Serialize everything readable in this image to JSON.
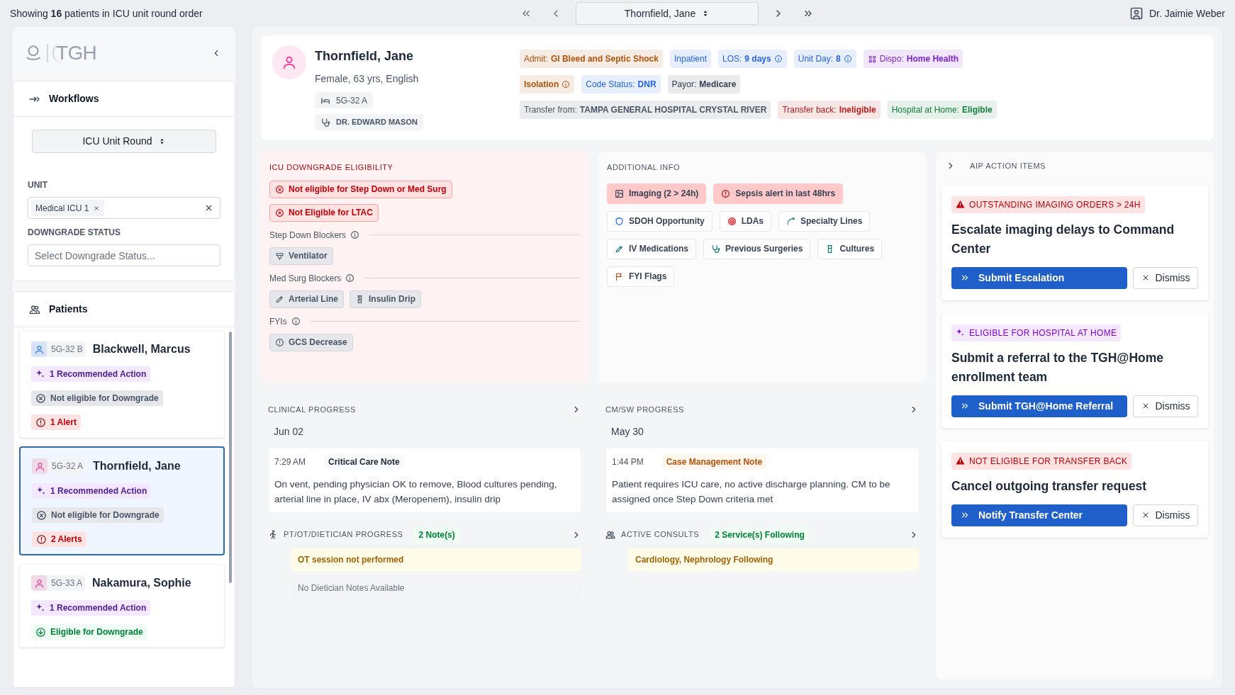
{
  "top_bar": {
    "summary": "Showing **16** patients in ICU unit round order",
    "current_patient": "Thornfield, Jane",
    "user": "Dr. Jaimie Weber"
  },
  "sidebar": {
    "logo": "TGH",
    "workflows": {
      "title": "Workflows",
      "workflow": "ICU Unit Round",
      "unit_label": "UNIT",
      "unit_chip": "Medical ICU 1",
      "status_label": "DOWNGRADE STATUS",
      "status_placeholder": "Select Downgrade Status..."
    },
    "patients": {
      "title": "Patients",
      "items": [
        {
          "room": "5G-32 B",
          "name": "Blackwell, Marcus",
          "color": "#3b82f6",
          "selected": false,
          "recommended": "1 Recommended Action",
          "downgrade": {
            "text": "Not eligible for Downgrade",
            "eligible": false
          },
          "alert": "1 Alert"
        },
        {
          "room": "5G-32 A",
          "name": "Thornfield, Jane",
          "color": "#ec4899",
          "selected": true,
          "recommended": "1 Recommended Action",
          "downgrade": {
            "text": "Not eligible for Downgrade",
            "eligible": false
          },
          "alert": "2 Alerts"
        },
        {
          "room": "5G-33 A",
          "name": "Nakamura, Sophie",
          "color": "#ec4899",
          "selected": false,
          "recommended": "1 Recommended Action",
          "downgrade": {
            "text": "Eligible for Downgrade",
            "eligible": true
          }
        }
      ]
    }
  },
  "header": {
    "name": "Thornfield, Jane",
    "details": "Female, 63 yrs, English",
    "room": "5G-32 A",
    "doctor": "DR. EDWARD MASON",
    "chip_rows": [
      [
        {
          "label": "Admit:",
          "value": "GI Bleed and Septic Shock",
          "color": "#b45309"
        },
        {
          "label": "Inpatient",
          "color": "#2563eb"
        },
        {
          "label": "LOS:",
          "value": "9 days",
          "color": "#2563eb",
          "info": true
        },
        {
          "label": "Unit Day:",
          "value": "8",
          "color": "#2563eb",
          "info": true
        },
        {
          "label": "Dispo:",
          "value": "Home Health",
          "color": "#7e22ce"
        }
      ],
      [
        {
          "value": "Isolation",
          "color": "#b45309",
          "info": true
        },
        {
          "label": "Code Status:",
          "value": "DNR",
          "color": "#2563eb"
        },
        {
          "label": "Payor:",
          "value": "Medicare",
          "color": "#374151"
        }
      ],
      [
        {
          "label": "Transfer from:",
          "value": "TAMPA GENERAL HOSPITAL CRYSTAL RIVER",
          "color": "#4b5563"
        },
        {
          "label": "Transfer back:",
          "value": "Ineligible",
          "color": "#b91c1c"
        },
        {
          "label": "Hospital at Home:",
          "value": "Eligible",
          "color": "#15803d"
        }
      ]
    ]
  },
  "downgrade": {
    "title": "ICU DOWNGRADE ELIGIBILITY",
    "statuses": [
      "Not eligible for Step Down or Med Surg",
      "Not Eligible for LTAC"
    ],
    "groups": [
      {
        "title": "Step Down Blockers",
        "items": [
          "Ventilator"
        ]
      },
      {
        "title": "Med Surg Blockers",
        "items": [
          "Arterial Line",
          "Insulin Drip"
        ]
      },
      {
        "title": "FYIs",
        "items": [
          "GCS Decrease"
        ]
      }
    ]
  },
  "additional_info": {
    "title": "ADDITIONAL INFO",
    "items": [
      {
        "label": "Imaging (2 > 24h)",
        "highlighted": true
      },
      {
        "label": "Sepsis alert in last 48hrs",
        "highlighted": true
      },
      {
        "label": "SDOH Opportunity",
        "highlighted": false
      },
      {
        "label": "LDAs",
        "highlighted": false
      },
      {
        "label": "Specialty Lines",
        "highlighted": false
      },
      {
        "label": "IV Medications",
        "highlighted": false
      },
      {
        "label": "Previous Surgeries",
        "highlighted": false
      },
      {
        "label": "Cultures",
        "highlighted": false
      },
      {
        "label": "FYI Flags",
        "highlighted": false
      }
    ]
  },
  "clinical_progress": {
    "title": "CLINICAL PROGRESS",
    "date": "Jun 02",
    "time": "7:29 AM",
    "note_type": "Critical Care Note",
    "highlighted": false,
    "text": "On vent, pending physician OK to remove, Blood cultures pending, arterial line in place, IV abx (Meropenem), insulin drip"
  },
  "cmsw_progress": {
    "title": "CM/SW PROGRESS",
    "date": "May 30",
    "time": "1:44 PM",
    "note_type": "Case Management Note",
    "highlighted": true,
    "text": "Patient requires ICU care, no active discharge planning. CM to be assigned once Step Down criteria met"
  },
  "pt_ot_progress": {
    "title": "PT/OT/DIETICIAN PROGRESS",
    "badge": "2 Note(s)",
    "notes": [
      {
        "text": "OT session not performed",
        "highlighted": true
      },
      {
        "text": "No Dietician Notes Available",
        "highlighted": false
      }
    ]
  },
  "active_consults": {
    "title": "ACTIVE CONSULTS",
    "badge": "2 Service(s) Following",
    "notes": [
      {
        "text": "Cardiology, Nephrology Following",
        "highlighted": true
      }
    ]
  },
  "aip": {
    "title": "AIP ACTION ITEMS",
    "items": [
      {
        "kind": "warning",
        "category": "OUTSTANDING IMAGING ORDERS > 24H",
        "title": "Escalate imaging delays to Command Center",
        "action": "Submit Escalation",
        "dismiss": "Dismiss"
      },
      {
        "kind": "eligible",
        "category": "ELIGIBLE FOR HOSPITAL AT HOME",
        "title": "Submit a referral to the TGH@Home enrollment team",
        "action": "Submit TGH@Home Referral",
        "dismiss": "Dismiss"
      },
      {
        "kind": "warning",
        "category": "NOT ELIGIBLE FOR TRANSFER BACK",
        "title": "Cancel outgoing transfer request",
        "action": "Notify Transfer Center",
        "dismiss": "Dismiss"
      }
    ]
  }
}
